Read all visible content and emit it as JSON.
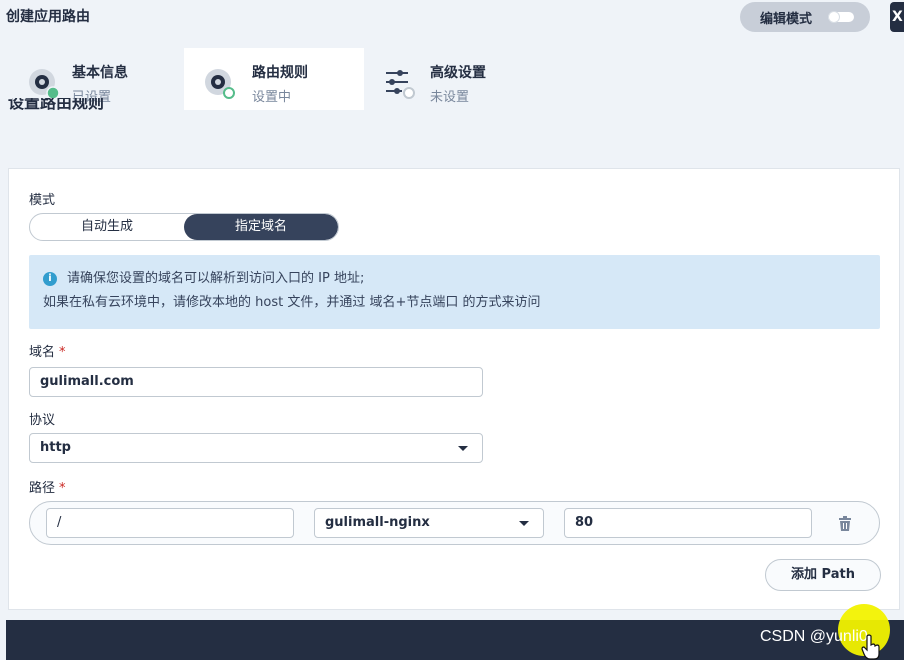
{
  "header": {
    "title": "创建应用路由",
    "edit_mode_label": "编辑模式",
    "close_label": "X"
  },
  "steps": [
    {
      "title": "基本信息",
      "status": "已设置",
      "state": "done"
    },
    {
      "title": "路由规则",
      "status": "设置中",
      "state": "active"
    },
    {
      "title": "高级设置",
      "status": "未设置",
      "state": "todo"
    }
  ],
  "section_title_behind": "设置路由规则",
  "mode": {
    "label": "模式",
    "options": [
      "自动生成",
      "指定域名"
    ],
    "selected": "指定域名"
  },
  "info": {
    "line1": "请确保您设置的域名可以解析到访问入口的 IP 地址;",
    "line2": "如果在私有云环境中，请修改本地的 host 文件，并通过 域名+节点端口 的方式来访问"
  },
  "domain": {
    "label": "域名",
    "required_mark": "*",
    "value": "gulimall.com"
  },
  "protocol": {
    "label": "协议",
    "value": "http"
  },
  "path": {
    "label": "路径",
    "required_mark": "*",
    "value": "/",
    "service": "gulimall-nginx",
    "port": "80"
  },
  "add_path_label": "添加 Path",
  "watermark": "CSDN @yunli0",
  "colors": {
    "accent_dark": "#242e42",
    "success_green": "#55bc8a",
    "info_blue": "#329dce",
    "info_bg": "#d6e8f7",
    "cursor_highlight": "#f2f200"
  }
}
